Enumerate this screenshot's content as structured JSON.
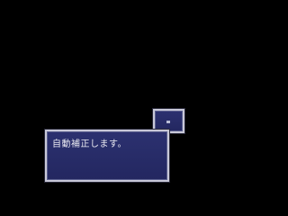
{
  "dialog": {
    "message": "自動補正します。"
  },
  "icon_window": {
    "icon": "square-cursor-icon"
  },
  "colors": {
    "background": "#000000",
    "window_fill": "#2c3170",
    "window_border": "#c8c8d8",
    "text": "#e8e8f0"
  }
}
